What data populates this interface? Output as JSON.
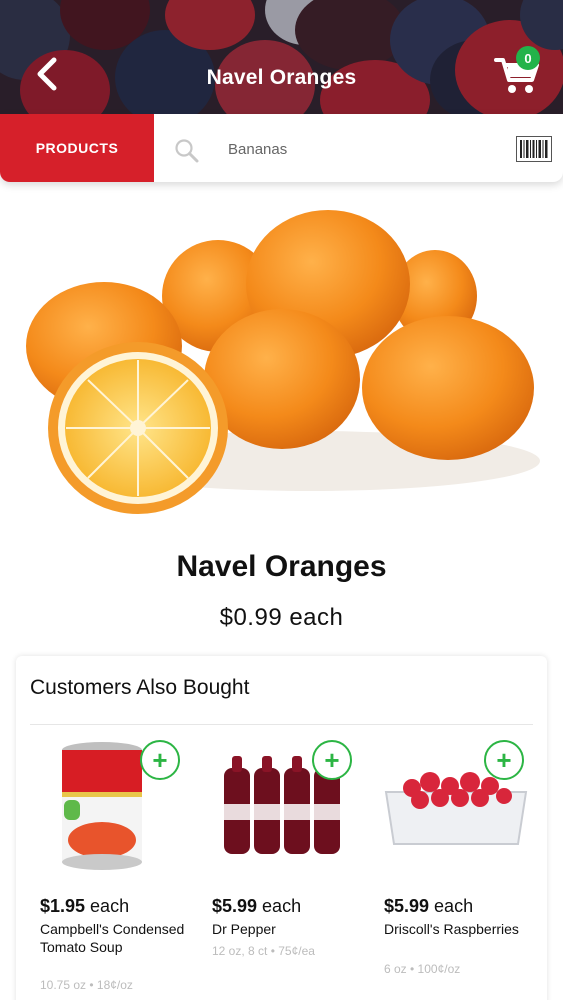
{
  "header": {
    "title": "Navel Oranges",
    "back_icon": "chevron-left-icon",
    "cart_icon": "cart-icon",
    "cart_count": "0",
    "cart_badge_color": "#23b34a"
  },
  "search": {
    "products_label": "PRODUCTS",
    "products_color": "#d6202a",
    "placeholder": "Bananas",
    "search_icon": "search-icon",
    "barcode_icon": "barcode-icon"
  },
  "product": {
    "name": "Navel Oranges",
    "price": "$0.99 each"
  },
  "also_bought": {
    "title": "Customers Also Bought",
    "add_label": "+",
    "add_color": "#2cb544",
    "items": [
      {
        "price": "$1.95",
        "unit": " each",
        "name": "Campbell's Condensed Tomato Soup",
        "meta": "10.75 oz • 18¢/oz"
      },
      {
        "price": "$5.99",
        "unit": " each",
        "name": "Dr Pepper",
        "meta": "12 oz, 8 ct • 75¢/ea"
      },
      {
        "price": "$5.99",
        "unit": " each",
        "name": "Driscoll's Raspberries",
        "meta": "6 oz • 100¢/oz"
      }
    ]
  }
}
